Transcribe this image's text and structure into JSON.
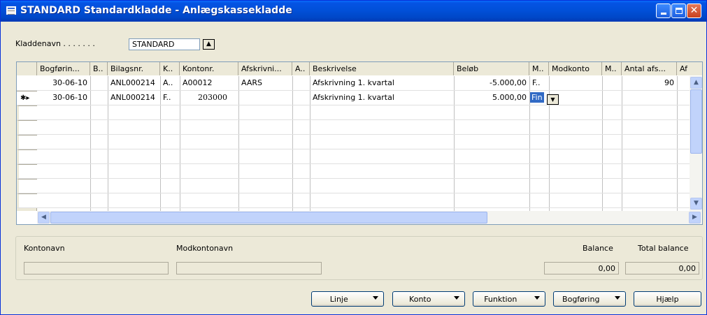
{
  "window": {
    "title": "STANDARD Standardkladde - Anlægskassekladde"
  },
  "journal": {
    "label": "Kladdenavn . . . . . . .",
    "value": "STANDARD"
  },
  "table": {
    "headers": [
      "Bogførin...",
      "B..",
      "Bilagsnr.",
      "K..",
      "Kontonr.",
      "Afskrivni...",
      "A..",
      "Beskrivelse",
      "Beløb",
      "M..",
      "Modkonto",
      "M..",
      "Antal afs...",
      "Af"
    ],
    "rows": [
      {
        "date": "30-06-10",
        "b": "",
        "doc": "ANL000214",
        "k": "A..",
        "account": "A00012",
        "depr": "AARS",
        "a": "",
        "desc": "Afskrivning 1. kvartal",
        "amount": "-5.000,00",
        "m": "F..",
        "bal_account": "",
        "m2": "",
        "count": "90"
      },
      {
        "date": "30-06-10",
        "b": "",
        "doc": "ANL000214",
        "k": "F..",
        "account": "203000",
        "depr": "",
        "a": "",
        "desc": "Afskrivning 1. kvartal",
        "amount": "5.000,00",
        "m": "Fin",
        "bal_account": "",
        "m2": "",
        "count": ""
      }
    ],
    "new_row_marker": "✱▸"
  },
  "info": {
    "account_name_label": "Kontonavn",
    "bal_account_name_label": "Modkontonavn",
    "balance_label": "Balance",
    "balance_value": "0,00",
    "total_balance_label": "Total balance",
    "total_balance_value": "0,00"
  },
  "buttons": {
    "line": "Linje",
    "account": "Konto",
    "function": "Funktion",
    "posting": "Bogføring",
    "help": "Hjælp"
  },
  "icons": {
    "window_icon": "journal-window-icon",
    "lookup": "lookup-arrow-icon",
    "dropdown": "chevron-down-icon"
  }
}
